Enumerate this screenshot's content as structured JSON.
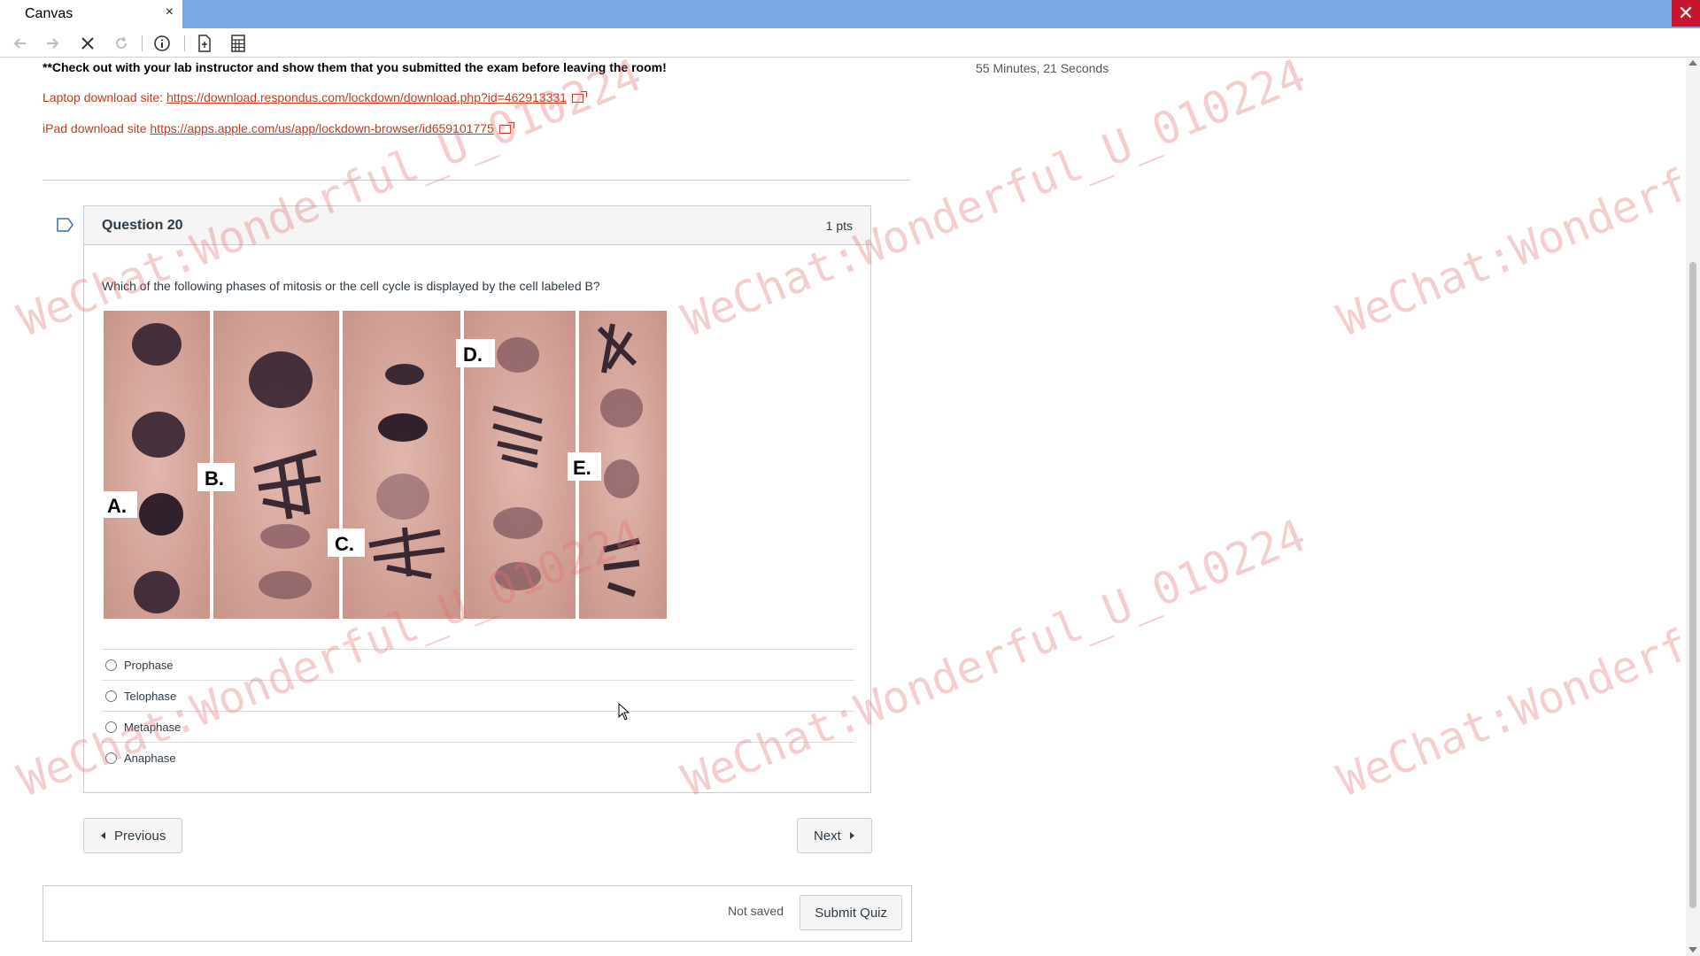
{
  "window": {
    "tab_title": "Canvas",
    "tab_close": "×",
    "close_glyph": "✕"
  },
  "toolbar": {
    "icons": [
      "back-icon",
      "forward-icon",
      "stop-icon",
      "reload-icon",
      "info-icon",
      "document-icon",
      "calculator-icon"
    ]
  },
  "page": {
    "notice": "**Check out with your lab instructor and show them that you submitted the exam before leaving the room!",
    "timer": "55 Minutes, 21 Seconds",
    "laptop_label": "Laptop download site: ",
    "laptop_url": "https://download.respondus.com/lockdown/download.php?id=462913331",
    "ipad_label": "iPad download site ",
    "ipad_url": "https://apps.apple.com/us/app/lockdown-browser/id659101775"
  },
  "question": {
    "title": "Question 20",
    "points": "1 pts",
    "text": "Which of the following phases of mitosis or the cell cycle is displayed by the cell labeled B?",
    "image_labels": [
      "A.",
      "B.",
      "C.",
      "D.",
      "E."
    ],
    "answers": [
      "Prophase",
      "Telophase",
      "Metaphase",
      "Anaphase"
    ]
  },
  "nav": {
    "previous": "Previous",
    "next": "Next"
  },
  "footer": {
    "status": "Not saved",
    "submit": "Submit Quiz"
  },
  "watermark": "WeChat:Wonderful_U_010224",
  "colors": {
    "titlebar": "#7aa7e6",
    "link": "#c23b22",
    "window_close": "#c7152f"
  }
}
